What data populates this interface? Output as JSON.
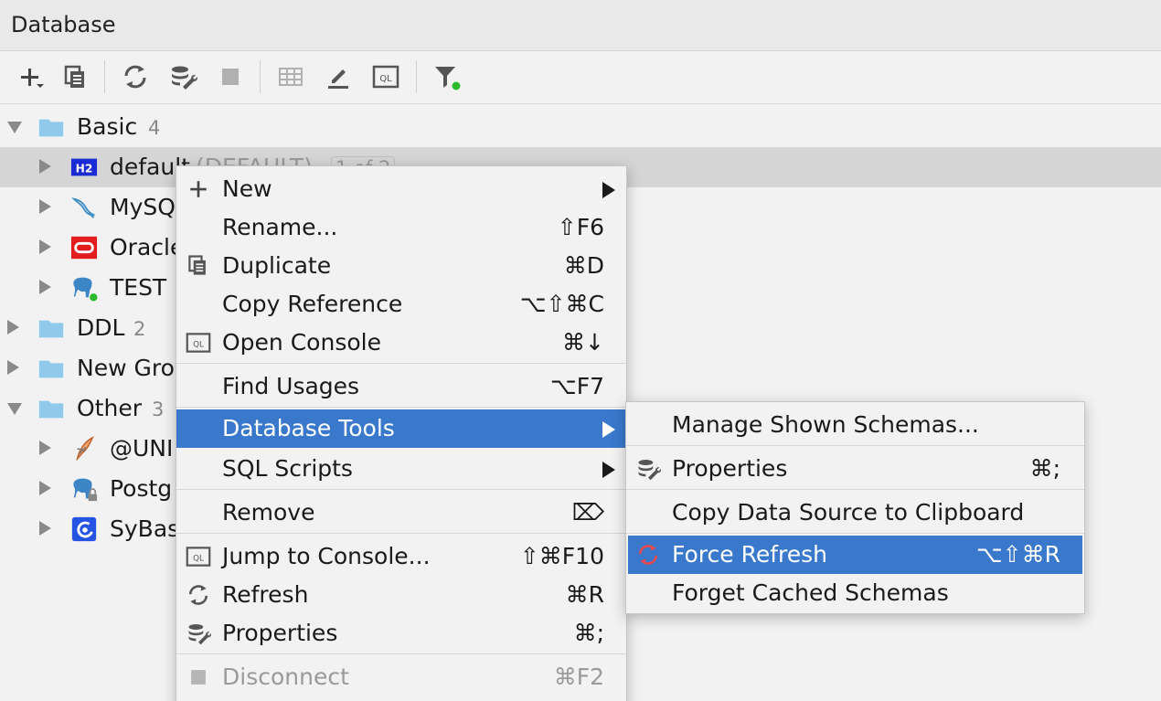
{
  "window": {
    "title": "Database"
  },
  "toolbar": {
    "items": [
      "add-icon",
      "duplicate-icon",
      "refresh-icon",
      "properties-icon",
      "stop-icon",
      "table-icon",
      "edit-icon",
      "console-icon",
      "filter-icon"
    ]
  },
  "tree": {
    "rows": [
      {
        "label": "Basic",
        "count": "4",
        "kind": "group",
        "expanded": true
      },
      {
        "label": "default",
        "extra": "(DEFAULT)",
        "badge": "1 of 2",
        "kind": "h2",
        "selected": true
      },
      {
        "label": "MySQ",
        "kind": "mysql"
      },
      {
        "label": "Oracle",
        "kind": "oracle"
      },
      {
        "label": "TEST",
        "kind": "postgres"
      },
      {
        "label": "DDL",
        "count": "2",
        "kind": "group"
      },
      {
        "label": "New Gro",
        "kind": "group"
      },
      {
        "label": "Other",
        "count": "3",
        "kind": "group",
        "expanded": true
      },
      {
        "label": "@UNI",
        "kind": "sqlite"
      },
      {
        "label": "Postg",
        "kind": "postgres-locked"
      },
      {
        "label": "SyBas",
        "kind": "sybase"
      }
    ],
    "h2_icon_text": "H2"
  },
  "context_menu": {
    "items": [
      {
        "label": "New",
        "shortcut": "",
        "submenu": true,
        "icon": "plus-icon"
      },
      {
        "label": "Rename...",
        "shortcut": "⇧F6"
      },
      {
        "label": "Duplicate",
        "shortcut": "⌘D",
        "icon": "duplicate-icon"
      },
      {
        "label": "Copy Reference",
        "shortcut": "⌥⇧⌘C"
      },
      {
        "label": "Open Console",
        "shortcut": "⌘↓",
        "icon": "console-icon"
      },
      {
        "label": "Find Usages",
        "shortcut": "⌥F7"
      },
      {
        "label": "Database Tools",
        "shortcut": "",
        "submenu": true,
        "highlighted": true
      },
      {
        "label": "SQL Scripts",
        "shortcut": "",
        "submenu": true
      },
      {
        "label": "Remove",
        "shortcut": "⌦"
      },
      {
        "label": "Jump to Console...",
        "shortcut": "⇧⌘F10",
        "icon": "console-icon"
      },
      {
        "label": "Refresh",
        "shortcut": "⌘R",
        "icon": "refresh-icon"
      },
      {
        "label": "Properties",
        "shortcut": "⌘;",
        "icon": "properties-icon"
      },
      {
        "label": "Disconnect",
        "shortcut": "⌘F2",
        "icon": "stop-icon",
        "disabled": true
      }
    ]
  },
  "submenu": {
    "items": [
      {
        "label": "Manage Shown Schemas...",
        "shortcut": ""
      },
      {
        "label": "Properties",
        "shortcut": "⌘;",
        "icon": "properties-icon"
      },
      {
        "label": "Copy Data Source to Clipboard",
        "shortcut": ""
      },
      {
        "label": "Force Refresh",
        "shortcut": "⌥⇧⌘R",
        "icon": "force-refresh-icon",
        "highlighted": true
      },
      {
        "label": "Forget Cached Schemas",
        "shortcut": ""
      }
    ]
  },
  "colors": {
    "highlight": "#3a78cc",
    "folder": "#8fc9ec",
    "green_dot": "#2aba2a",
    "oracle_red": "#e31d1d"
  },
  "icon_text": {
    "console": "QL"
  }
}
